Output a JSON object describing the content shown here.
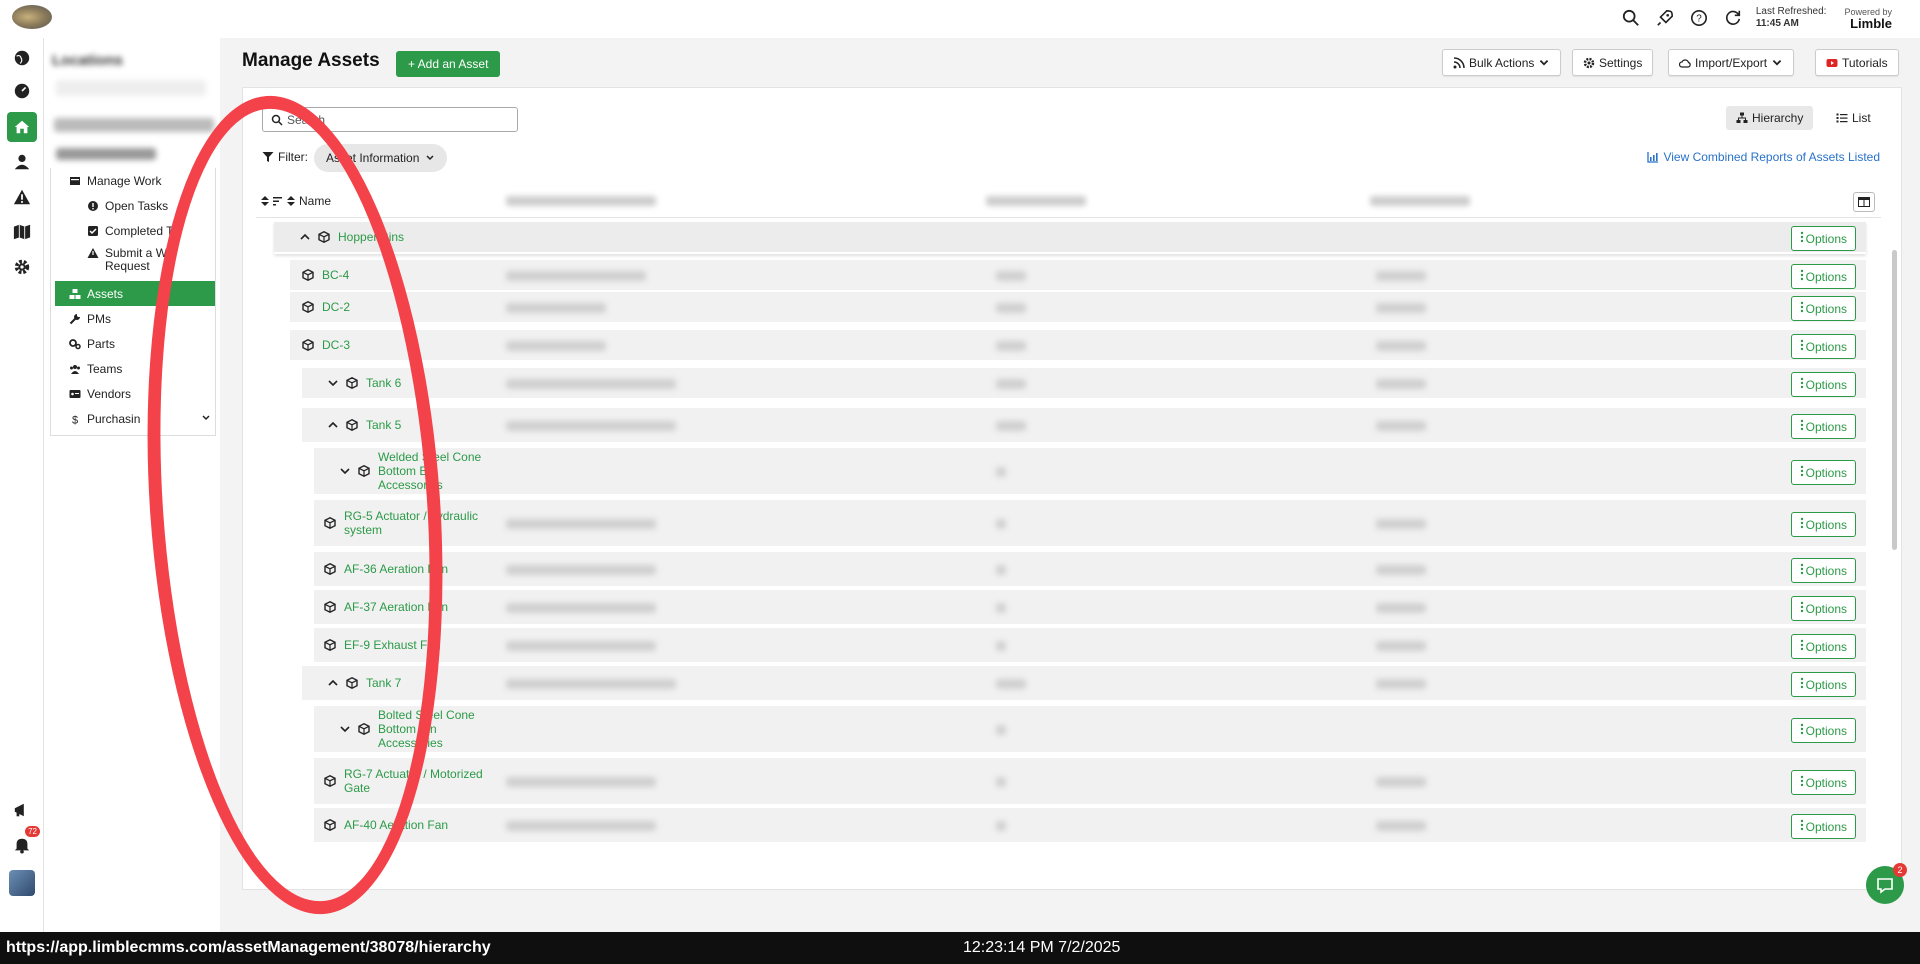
{
  "topbar": {
    "last_refreshed_label": "Last Refreshed:",
    "last_refreshed_time": "11:45 AM",
    "powered_by": "Powered by",
    "brand": "Limble"
  },
  "rail": {
    "notification_count": "72"
  },
  "sidebar": {
    "heading": "Locations",
    "items": [
      {
        "label": "Manage Work",
        "icon": "inbox-icon"
      },
      {
        "label": "Open Tasks",
        "icon": "alert-circle-icon"
      },
      {
        "label": "Completed Ta",
        "icon": "checkbox-icon"
      },
      {
        "label": "Submit a Wo Request",
        "icon": "warning-icon"
      },
      {
        "label": "Assets",
        "icon": "assets-icon"
      },
      {
        "label": "PMs",
        "icon": "wrench-icon"
      },
      {
        "label": "Parts",
        "icon": "gears-icon"
      },
      {
        "label": "Teams",
        "icon": "users-icon"
      },
      {
        "label": "Vendors",
        "icon": "id-card-icon"
      },
      {
        "label": "Purchasin",
        "icon": "dollar-icon"
      }
    ]
  },
  "header": {
    "title": "Manage Assets",
    "add_label": "+ Add an Asset",
    "bulk_actions": "Bulk Actions",
    "settings": "Settings",
    "import_export": "Import/Export",
    "tutorials": "Tutorials"
  },
  "toolbar": {
    "search_placeholder": "Search",
    "hierarchy": "Hierarchy",
    "list": "List",
    "filter_label": "Filter:",
    "filter_chip": "Asset Information",
    "reports_link": "View Combined Reports of Assets Listed"
  },
  "table": {
    "name_header": "Name",
    "options_label": "Options",
    "rows": [
      {
        "name": "Hopper Bins",
        "caret": "^"
      },
      {
        "name": "BC-4",
        "caret": ""
      },
      {
        "name": "DC-2",
        "caret": ""
      },
      {
        "name": "DC-3",
        "caret": ""
      },
      {
        "name": "Tank 6",
        "caret": "v"
      },
      {
        "name": "Tank 5",
        "caret": "^"
      },
      {
        "name": "Welded Steel Cone Bottom Bin Accessories",
        "caret": "v"
      },
      {
        "name": "RG-5 Actuator / hydraulic system",
        "caret": ""
      },
      {
        "name": "AF-36 Aeration Fan",
        "caret": ""
      },
      {
        "name": "AF-37 Aeration Fan",
        "caret": ""
      },
      {
        "name": "EF-9 Exhaust Fan",
        "caret": ""
      },
      {
        "name": "Tank 7",
        "caret": "^"
      },
      {
        "name": "Bolted Steel Cone Bottom Bin Accessories",
        "caret": "v"
      },
      {
        "name": "RG-7 Actuator / Motorized Gate",
        "caret": ""
      },
      {
        "name": "AF-40 Aeration Fan",
        "caret": ""
      }
    ]
  },
  "chat": {
    "badge": "2"
  },
  "statusbar": {
    "url": "https://app.limblecmms.com/assetManagement/38078/hierarchy",
    "datetime": "12:23:14 PM 7/2/2025"
  },
  "colors": {
    "accent": "#2c9a48",
    "link": "#2872c9",
    "annotation": "#f4424a"
  }
}
